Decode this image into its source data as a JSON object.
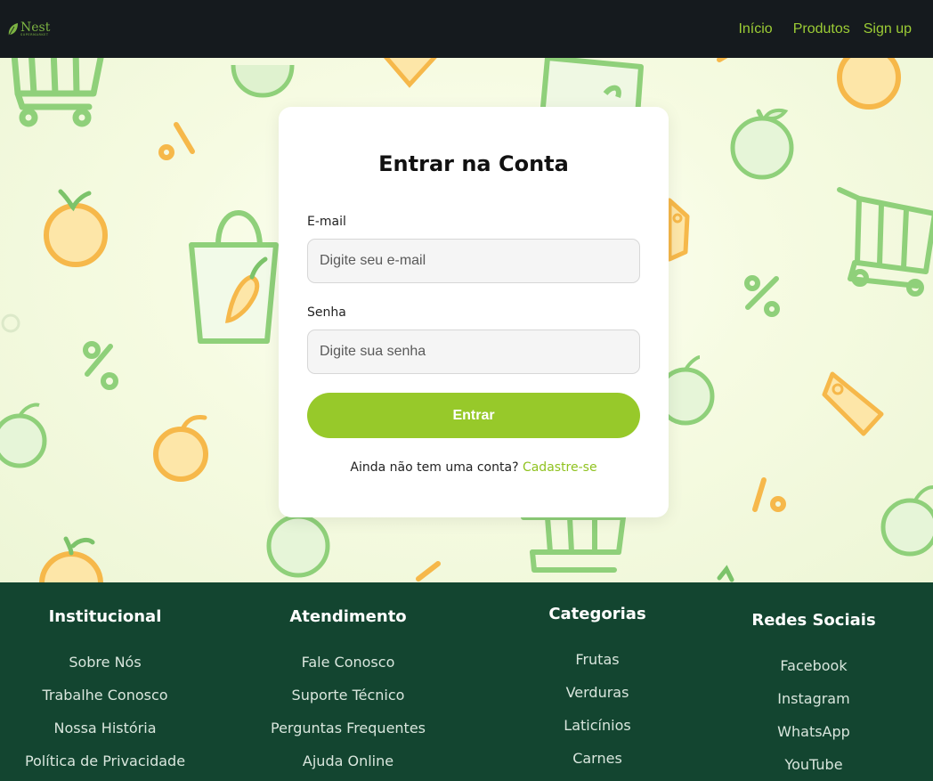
{
  "brand": {
    "name": "Nest",
    "tagline": "SUPERMARKET"
  },
  "nav": {
    "links": [
      "Início",
      "Produtos",
      "Sign up"
    ]
  },
  "login": {
    "title": "Entrar na Conta",
    "email_label": "E-mail",
    "email_placeholder": "Digite seu e-mail",
    "password_label": "Senha",
    "password_placeholder": "Digite sua senha",
    "submit_label": "Entrar",
    "no_account_text": "Ainda não tem uma conta?",
    "signup_link": "Cadastre-se"
  },
  "footer": {
    "columns": [
      {
        "title": "Institucional",
        "links": [
          "Sobre Nós",
          "Trabalhe Conosco",
          "Nossa História",
          "Política de Privacidade"
        ]
      },
      {
        "title": "Atendimento",
        "links": [
          "Fale Conosco",
          "Suporte Técnico",
          "Perguntas Frequentes",
          "Ajuda Online"
        ]
      },
      {
        "title": "Categorias",
        "links": [
          "Frutas",
          "Verduras",
          "Laticínios",
          "Carnes"
        ]
      },
      {
        "title": "Redes Sociais",
        "links": [
          "Facebook",
          "Instagram",
          "WhatsApp",
          "YouTube"
        ]
      }
    ]
  },
  "colors": {
    "nav_bg": "#151a1e",
    "accent_green": "#97c92a",
    "footer_bg": "#134530",
    "deco_green": "#7cc36a",
    "deco_orange": "#f6b84a"
  },
  "icons": [
    "leaf-logo-icon",
    "shopping-cart-icon",
    "apple-icon",
    "orange-icon",
    "percent-icon",
    "price-tag-icon",
    "shopping-bag-icon",
    "carrot-icon"
  ]
}
